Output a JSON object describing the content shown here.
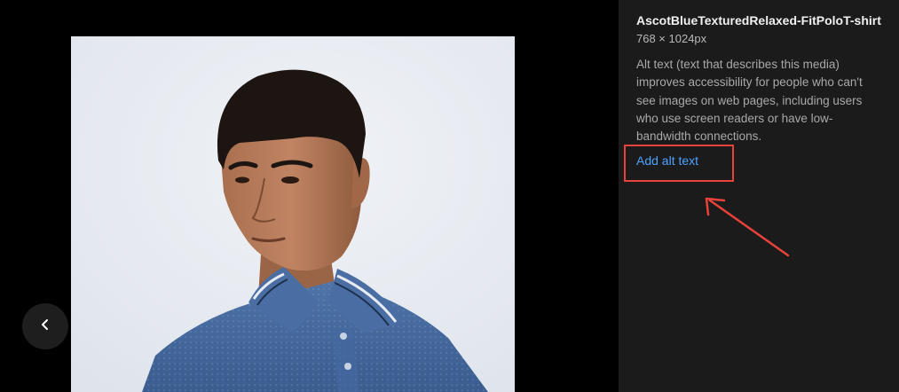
{
  "image_info": {
    "title": "AscotBlueTexturedRelaxed-FitPoloT-shirt",
    "dimensions": "768 × 1024px"
  },
  "alt_text": {
    "description": "Alt text (text that describes this media) improves accessibility for people who can't see images on web pages, including users who use screen readers or have low-bandwidth connections.",
    "add_link_label": "Add alt text"
  },
  "navigation": {
    "prev_icon": "chevron-left-icon"
  },
  "colors": {
    "panel_bg": "#1b1b1b",
    "link": "#4ea2ff",
    "annotation": "#e8423a"
  }
}
